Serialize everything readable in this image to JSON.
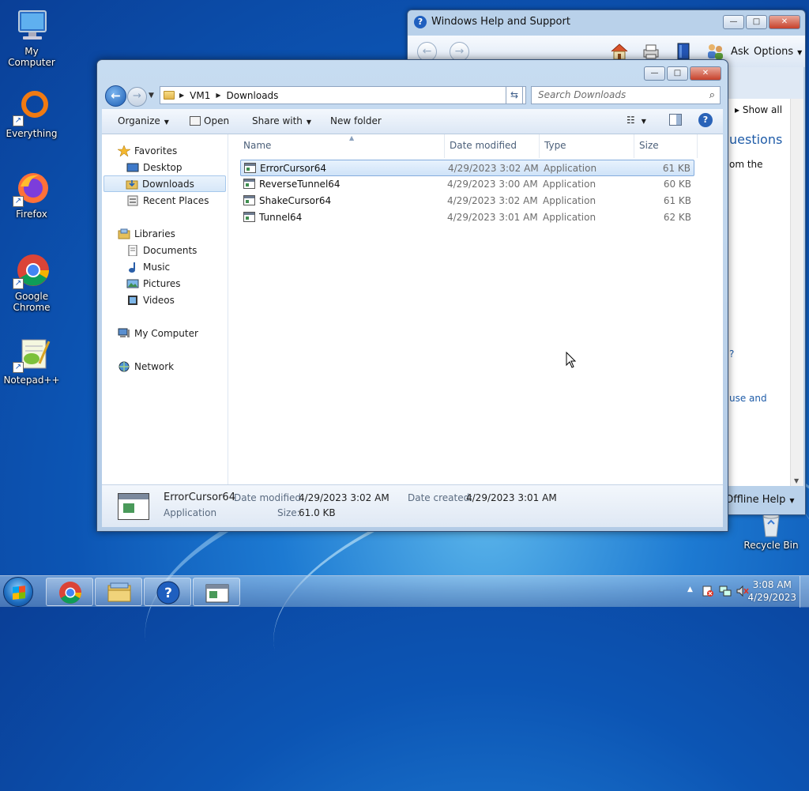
{
  "desktop": {
    "icons": [
      {
        "label": "My Computer"
      },
      {
        "label": "Everything"
      },
      {
        "label": "Firefox"
      },
      {
        "label": "Google Chrome"
      },
      {
        "label": "Notepad++"
      },
      {
        "label": "Recycle Bin"
      }
    ]
  },
  "help_window": {
    "title": "Windows Help and Support",
    "toolbar": {
      "ask_label": "Ask",
      "options_label": "Options"
    },
    "content": {
      "show_all": "Show all",
      "heading_fragment": "uestions",
      "line_fragment": "om the",
      "q_fragment": "?",
      "link_fragment": "use and"
    },
    "bottom": {
      "offline_help": "Offline Help"
    }
  },
  "explorer": {
    "breadcrumb": [
      "VM1",
      "Downloads"
    ],
    "search_placeholder": "Search Downloads",
    "commands": {
      "organize": "Organize",
      "open": "Open",
      "share_with": "Share with",
      "new_folder": "New folder"
    },
    "nav": {
      "favorites": "Favorites",
      "desktop": "Desktop",
      "downloads": "Downloads",
      "recent_places": "Recent Places",
      "libraries": "Libraries",
      "documents": "Documents",
      "music": "Music",
      "pictures": "Pictures",
      "videos": "Videos",
      "my_computer": "My Computer",
      "network": "Network"
    },
    "columns": {
      "name": "Name",
      "date_modified": "Date modified",
      "type": "Type",
      "size": "Size"
    },
    "files": [
      {
        "name": "ErrorCursor64",
        "date": "4/29/2023 3:02 AM",
        "type": "Application",
        "size": "61 KB"
      },
      {
        "name": "ReverseTunnel64",
        "date": "4/29/2023 3:00 AM",
        "type": "Application",
        "size": "60 KB"
      },
      {
        "name": "ShakeCursor64",
        "date": "4/29/2023 3:02 AM",
        "type": "Application",
        "size": "61 KB"
      },
      {
        "name": "Tunnel64",
        "date": "4/29/2023 3:01 AM",
        "type": "Application",
        "size": "62 KB"
      }
    ],
    "details": {
      "name": "ErrorCursor64",
      "type": "Application",
      "date_modified_label": "Date modified:",
      "date_modified": "4/29/2023 3:02 AM",
      "date_created_label": "Date created:",
      "date_created": "4/29/2023 3:01 AM",
      "size_label": "Size:",
      "size": "61.0 KB"
    }
  },
  "taskbar": {
    "clock_time": "3:08 AM",
    "clock_date": "4/29/2023"
  },
  "colors": {
    "accent": "#1f5fbf",
    "selection": "#cfe3f8"
  }
}
